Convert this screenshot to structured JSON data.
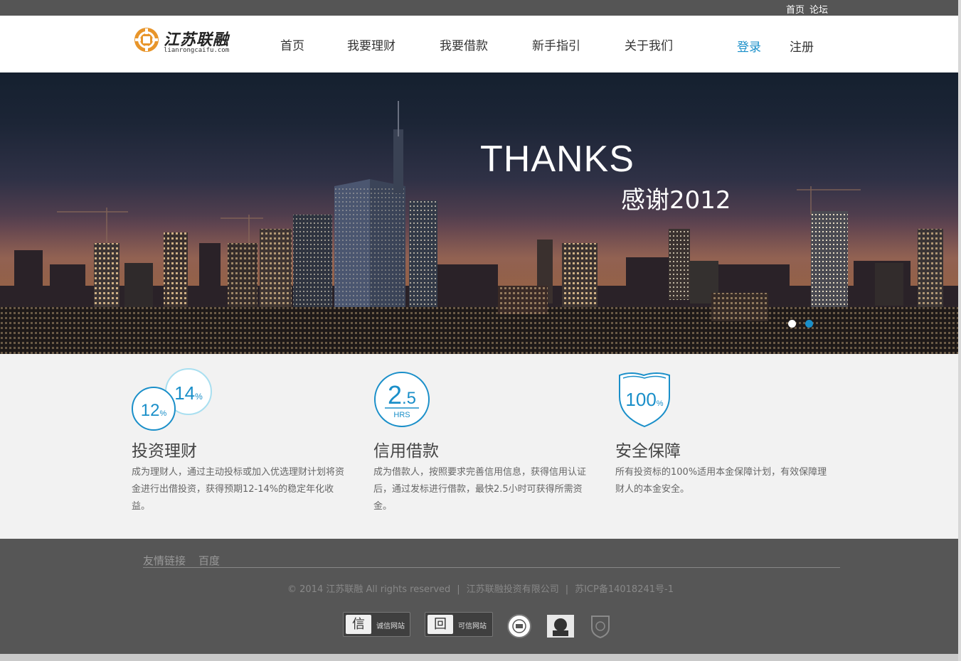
{
  "topbar": {
    "home": "首页",
    "forum": "论坛"
  },
  "logo": {
    "cn": "江苏联融",
    "en": "lianrongcaifu.com"
  },
  "nav": [
    {
      "label": "首页"
    },
    {
      "label": "我要理财"
    },
    {
      "label": "我要借款"
    },
    {
      "label": "新手指引"
    },
    {
      "label": "关于我们"
    }
  ],
  "auth": {
    "login": "登录",
    "register": "注册"
  },
  "banner": {
    "title": "THANKS",
    "subtitle": "感谢2012"
  },
  "features": [
    {
      "title": "投资理财",
      "desc": "成为理财人，通过主动投标或加入优选理财计划将资金进行出借投资，获得预期12-14%的稳定年化收益。",
      "icon_a": "12",
      "icon_b": "14",
      "unit": "%"
    },
    {
      "title": "信用借款",
      "desc": "成为借款人，按照要求完善信用信息，获得信用认证后，通过发标进行借款，最快2.5小时可获得所需资金。",
      "icon_a": "2",
      "icon_b": ".5",
      "unit": "HRS"
    },
    {
      "title": "安全保障",
      "desc": "所有投资标的100%适用本金保障计划，有效保障理财人的本金安全。",
      "icon_a": "100",
      "unit": "%"
    }
  ],
  "footer": {
    "links_label": "友情链接",
    "links": [
      "百度"
    ],
    "copyright": "© 2014 江苏联融 All rights reserved",
    "company": "江苏联融投资有限公司",
    "icp": "苏ICP备14018241号-1",
    "badge1": {
      "icon": "信",
      "text": "诚信网站"
    },
    "badge2": {
      "icon": "回",
      "text": "可信网站"
    }
  },
  "colors": {
    "accent": "#1a8fc9",
    "dark": "#555555",
    "orange": "#e8952a"
  }
}
